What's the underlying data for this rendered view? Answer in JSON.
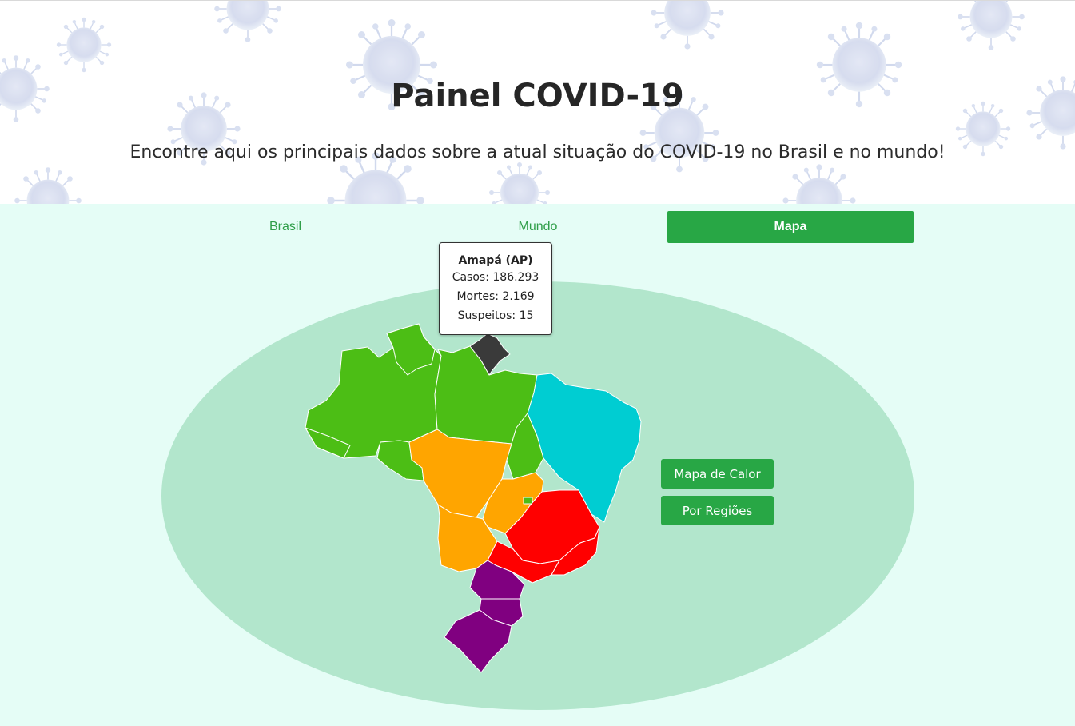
{
  "header": {
    "title": "Painel COVID-19",
    "subtitle": "Encontre aqui os principais dados sobre a atual situação do COVID-19 no Brasil e no mundo!"
  },
  "tabs": [
    {
      "label": "Brasil",
      "active": false
    },
    {
      "label": "Mundo",
      "active": false
    },
    {
      "label": "Mapa",
      "active": true
    }
  ],
  "tooltip": {
    "state": "Amapá (AP)",
    "cases": "Casos: 186.293",
    "deaths": "Mortes: 2.169",
    "suspects": "Suspeitos: 15"
  },
  "buttons": {
    "heatmap": "Mapa de Calor",
    "regions": "Por Regiões"
  },
  "colors": {
    "accent": "#28a745",
    "panel_bg": "#e5fdf6",
    "map_ellipse": "#b2e6cc",
    "region_norte": "#4cbe15",
    "region_nordeste": "#00cdd2",
    "region_centro_oeste": "#ffa500",
    "region_sudeste": "#ff0000",
    "region_sul": "#800080",
    "hovered_state": "#3a3a3a"
  },
  "icons": [
    "virus-icon"
  ]
}
